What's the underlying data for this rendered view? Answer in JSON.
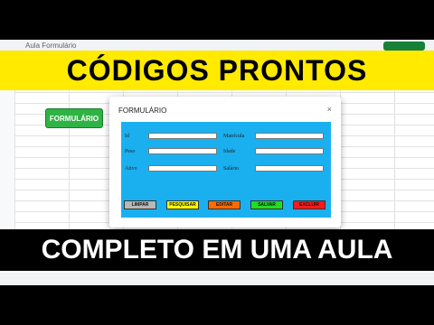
{
  "spreadsheet": {
    "tab_title": "Aula Formulário",
    "sheet_button": "FORMULÁRIO"
  },
  "banner": {
    "top": "CÓDIGOS PRONTOS",
    "bottom": "COMPLETO EM UMA AULA"
  },
  "modal": {
    "title": "FORMULÁRIO",
    "close": "×",
    "fields_left": [
      "Id",
      "Peso",
      "Ativo"
    ],
    "fields_right": [
      "Matrícula",
      "Idade",
      "Salário"
    ],
    "buttons": {
      "limpar": "LIMPAR",
      "pesquisar": "PESQUISAR",
      "editar": "EDITAR",
      "salvar": "SALVAR",
      "excluir": "EXCLUIR"
    }
  },
  "colors": {
    "banner_yellow": "#ffea00",
    "form_blue": "#1ab0f0",
    "limpar": "#b8b8b8",
    "pesquisar": "#ffff00",
    "editar": "#ff6a00",
    "salvar": "#22dd22",
    "excluir": "#ff1a1a"
  }
}
